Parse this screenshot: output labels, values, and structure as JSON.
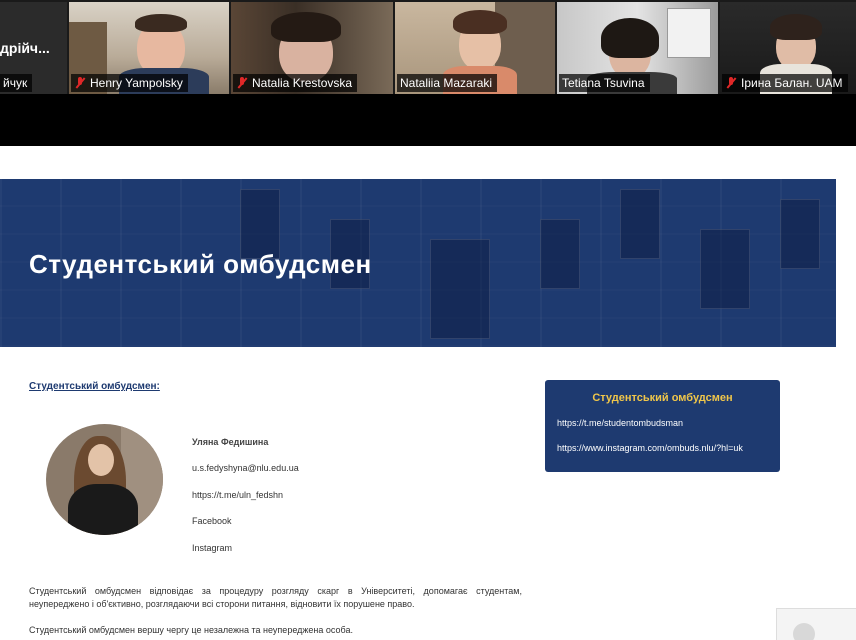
{
  "participants": [
    {
      "name": "дрійч...",
      "name2": "йчук",
      "muted": false
    },
    {
      "name": "Henry Yampolsky",
      "muted": true
    },
    {
      "name": "Natalia Krestovska",
      "muted": true
    },
    {
      "name": "Nataliia Mazaraki",
      "muted": false
    },
    {
      "name": "Tetiana Tsuvina",
      "muted": false,
      "active": true
    },
    {
      "name": "Ірина Балан. UAM",
      "muted": true
    }
  ],
  "page": {
    "banner_title": "Студентський омбудсмен",
    "section_label": "Студентський омбудсмен:",
    "contact": {
      "name": "Уляна Федишина",
      "email": "u.s.fedyshyna@nlu.edu.ua",
      "telegram": "https://t.me/uln_fedshn",
      "facebook": "Facebook",
      "instagram": "Instagram"
    },
    "paragraph1": "Студентський омбудсмен відповідає за процедуру розгляду скарг в Університеті, допомагає студентам, неупереджено і об'єктивно, розглядаючи всі сторони питання, відновити їх порушене право.",
    "paragraph2": "Студентський омбудсмен вершу чергу це незалежна та неупереджена особа.",
    "card": {
      "title": "Студентський омбудсмен",
      "link1": "https://t.me/studentombudsman",
      "link2": "https://www.instagram.com/ombuds.nlu/?hl=uk"
    }
  },
  "colors": {
    "banner": "#1e3a70",
    "card_title": "#f0c64a",
    "active_speaker": "#7fd23a",
    "muted_mic": "#e02828"
  }
}
